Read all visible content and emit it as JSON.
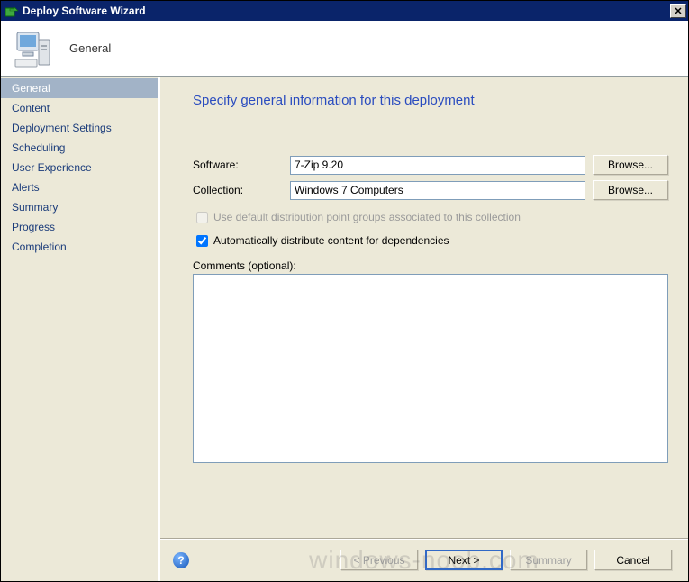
{
  "window": {
    "title": "Deploy Software Wizard"
  },
  "banner": {
    "title": "General"
  },
  "sidebar": {
    "items": [
      {
        "label": "General",
        "selected": true
      },
      {
        "label": "Content",
        "selected": false
      },
      {
        "label": "Deployment Settings",
        "selected": false
      },
      {
        "label": "Scheduling",
        "selected": false
      },
      {
        "label": "User Experience",
        "selected": false
      },
      {
        "label": "Alerts",
        "selected": false
      },
      {
        "label": "Summary",
        "selected": false
      },
      {
        "label": "Progress",
        "selected": false
      },
      {
        "label": "Completion",
        "selected": false
      }
    ]
  },
  "main": {
    "heading": "Specify general information for this deployment",
    "software_label": "Software:",
    "software_value": "7-Zip 9.20",
    "collection_label": "Collection:",
    "collection_value": "Windows 7 Computers",
    "browse_label": "Browse...",
    "use_default_dp_label": "Use default distribution point groups associated to this collection",
    "use_default_dp_checked": false,
    "auto_distribute_label": "Automatically distribute content for dependencies",
    "auto_distribute_checked": true,
    "comments_label": "Comments (optional):",
    "comments_value": ""
  },
  "footer": {
    "previous": "< Previous",
    "next": "Next >",
    "summary": "Summary",
    "cancel": "Cancel"
  },
  "watermark": "windows-noob.com"
}
